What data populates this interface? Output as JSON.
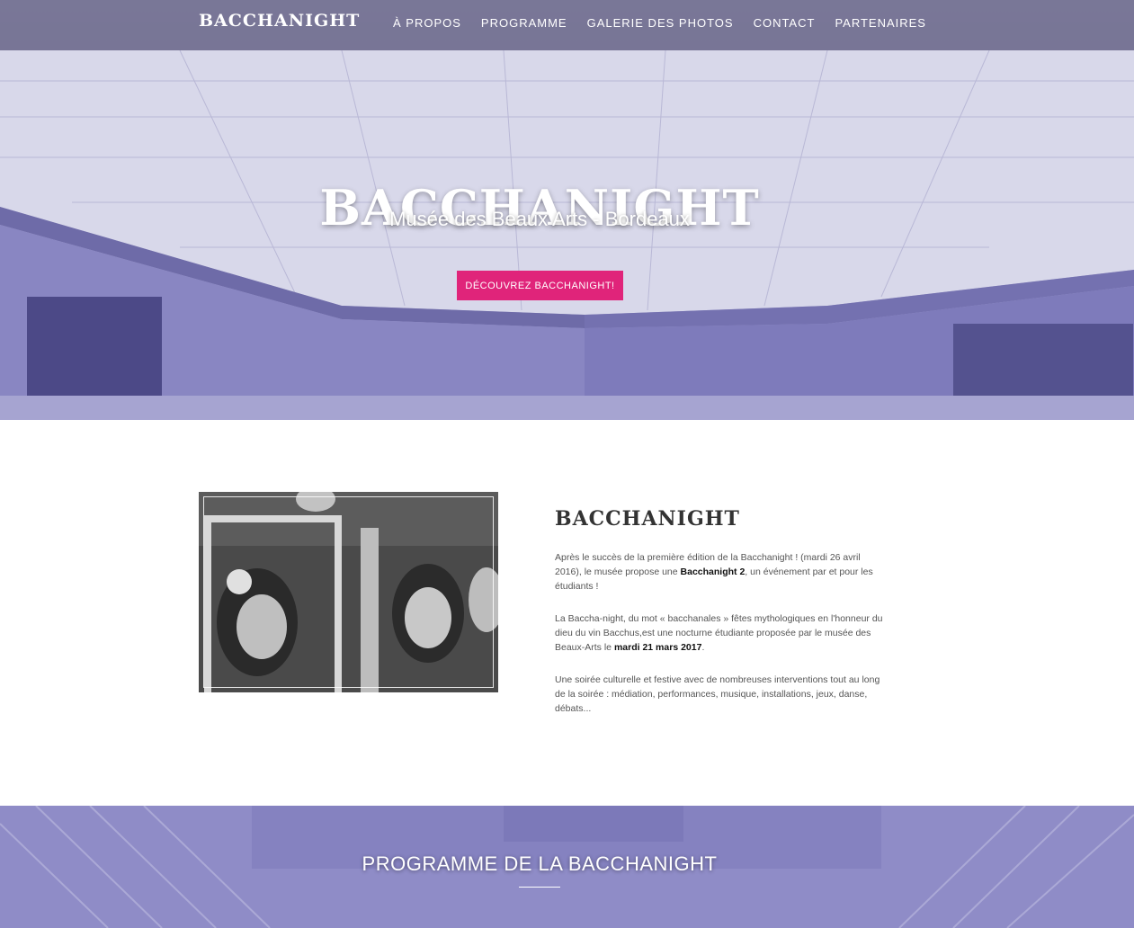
{
  "brand": "BACCHANIGHT",
  "nav": [
    "À PROPOS",
    "PROGRAMME",
    "GALERIE DES PHOTOS",
    "CONTACT",
    "PARTENAIRES"
  ],
  "hero": {
    "title": "BACCHANIGHT",
    "subtitle": "Musée des Beaux Arts - Bordeaux",
    "cta": "DÉCOUVREZ BACCHANIGHT!"
  },
  "about": {
    "heading": "BACCHANIGHT",
    "p1_a": "Après le succès de la première édition de la Bacchanight ! (mardi 26 avril 2016), le musée propose une ",
    "p1_bold": "Bacchanight 2",
    "p1_b": ", un événement par et pour les étudiants !",
    "p2_a": "La Baccha-night, du mot « bacchanales » fêtes mythologiques en l'honneur du dieu du vin Bacchus,est une nocturne étudiante proposée par le musée des Beaux-Arts le ",
    "p2_bold": "mardi 21 mars 2017",
    "p2_b": ".",
    "p3": "Une soirée culturelle et festive avec de nombreuses interventions tout au long de la soirée : médiation, performances, musique, installations, jeux, danse, débats..."
  },
  "programme": {
    "title": "PROGRAMME DE LA BACCHANIGHT"
  },
  "colors": {
    "accent": "#e0247a",
    "hero_overlay": "#8e8bc6",
    "navbar": "#484669"
  }
}
